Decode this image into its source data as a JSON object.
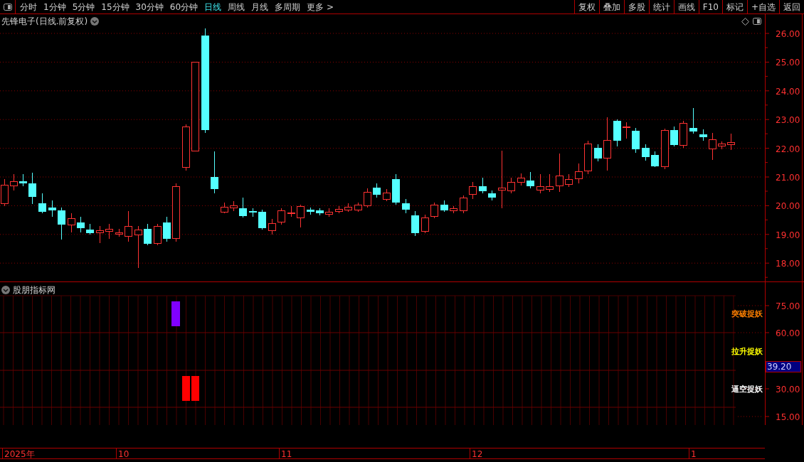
{
  "toolbar": {
    "periods": [
      {
        "label": "分时",
        "selected": false
      },
      {
        "label": "1分钟",
        "selected": false
      },
      {
        "label": "5分钟",
        "selected": false
      },
      {
        "label": "15分钟",
        "selected": false
      },
      {
        "label": "30分钟",
        "selected": false
      },
      {
        "label": "60分钟",
        "selected": false
      },
      {
        "label": "日线",
        "selected": true
      },
      {
        "label": "周线",
        "selected": false
      },
      {
        "label": "月线",
        "selected": false
      },
      {
        "label": "多周期",
        "selected": false
      },
      {
        "label": "更多 >",
        "selected": false
      }
    ],
    "buttons": [
      "复权",
      "叠加",
      "多股",
      "统计",
      "画线",
      "F10",
      "标记",
      "+自选",
      "返回"
    ]
  },
  "main_chart": {
    "title": "先锋电子(日线.前复权)",
    "price_axis": [
      "26.00",
      "25.00",
      "24.00",
      "23.00",
      "22.00",
      "21.00",
      "20.00",
      "19.00",
      "18.00"
    ]
  },
  "indicator": {
    "title": "股朋指标网",
    "value_axis": [
      "75.00",
      "60.00",
      "30.00",
      "15.00"
    ],
    "current_value": "39.20",
    "signals": [
      {
        "label": "突破捉妖",
        "color": "#ff8000"
      },
      {
        "label": "拉升捉妖",
        "color": "#ffff00"
      },
      {
        "label": "逼空捉妖",
        "color": "#ffffff"
      }
    ]
  },
  "time_axis": [
    "2025年",
    "10",
    "11",
    "12",
    "1"
  ]
}
